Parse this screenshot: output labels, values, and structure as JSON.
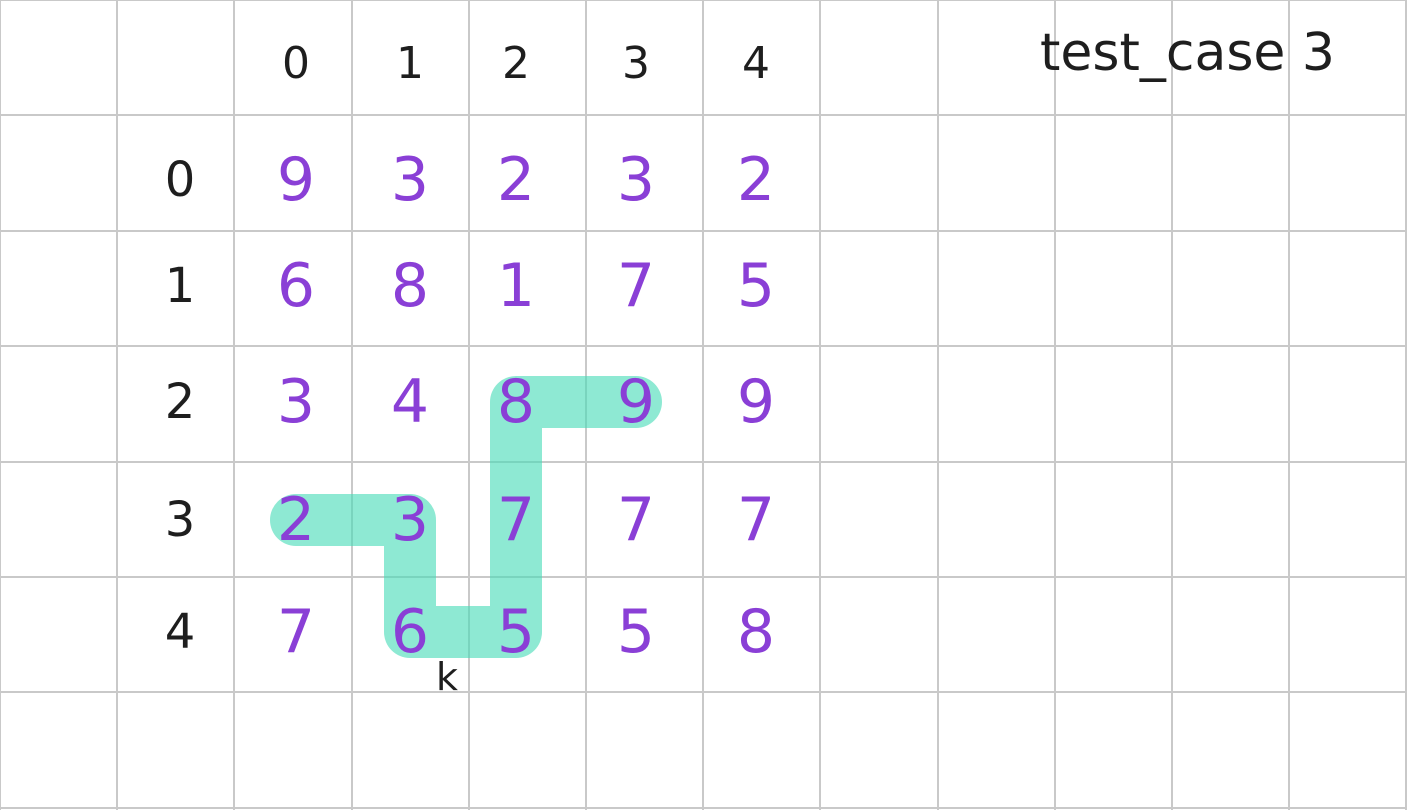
{
  "title": "test_case 3",
  "column_headers": [
    "0",
    "1",
    "2",
    "3",
    "4"
  ],
  "row_headers": [
    "0",
    "1",
    "2",
    "3",
    "4"
  ],
  "cells": [
    [
      "9",
      "3",
      "2",
      "3",
      "2"
    ],
    [
      "6",
      "8",
      "1",
      "7",
      "5"
    ],
    [
      "3",
      "4",
      "8",
      "9",
      "9"
    ],
    [
      "2",
      "3",
      "7",
      "7",
      "7"
    ],
    [
      "7",
      "6",
      "5",
      "5",
      "8"
    ]
  ],
  "path_cells": [
    [
      3,
      0
    ],
    [
      3,
      1
    ],
    [
      4,
      1
    ],
    [
      4,
      2
    ],
    [
      3,
      2
    ],
    [
      2,
      2
    ],
    [
      2,
      3
    ]
  ],
  "mark": "k",
  "colors": {
    "grid": "#c9c9c9",
    "header_ink": "#1e1e1e",
    "number_ink": "#8a3fd6",
    "highlight": "#48dcb8"
  }
}
